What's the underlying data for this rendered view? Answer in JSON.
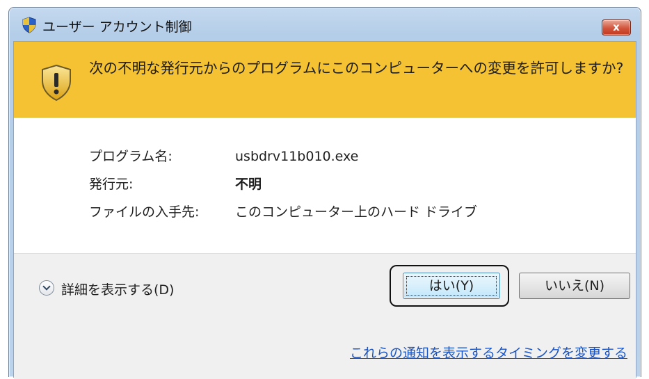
{
  "window": {
    "title": "ユーザー アカウント制御",
    "close_label": "x",
    "title_icon": "uac-shield-icon",
    "banner_color": "#f4c232"
  },
  "banner": {
    "icon": "warning-shield-icon",
    "message": "次の不明な発行元からのプログラムにこのコンピューターへの変更を許可しますか?"
  },
  "details": {
    "rows": [
      {
        "label": "プログラム名:",
        "value": "usbdrv11b010.exe"
      },
      {
        "label": "発行元:",
        "value": "不明"
      },
      {
        "label": "ファイルの入手先:",
        "value": "このコンピューター上のハード ドライブ"
      }
    ]
  },
  "footer": {
    "show_details": "詳細を表示する(D)",
    "yes_button": "はい(Y)",
    "no_button": "いいえ(N)",
    "change_link": "これらの通知を表示するタイミングを変更する"
  }
}
